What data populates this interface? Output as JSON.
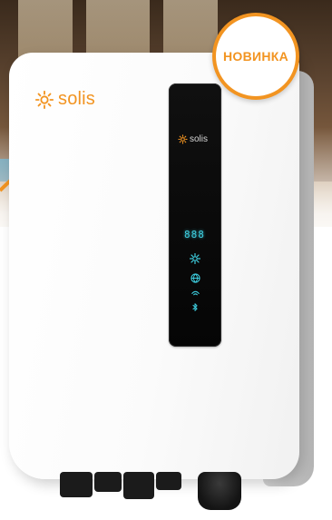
{
  "product": {
    "brand_logo_text": "solis",
    "panel_logo_text": "solis",
    "display_digits": "888",
    "badge_text": "НОВИНКА",
    "colors": {
      "brand_orange": "#f29421",
      "display_cyan": "#3ecfe0",
      "panel_black": "#0a0a0a"
    },
    "panel_icons": [
      "sun-icon",
      "grid-icon",
      "wifi-icon",
      "bluetooth-icon"
    ]
  }
}
